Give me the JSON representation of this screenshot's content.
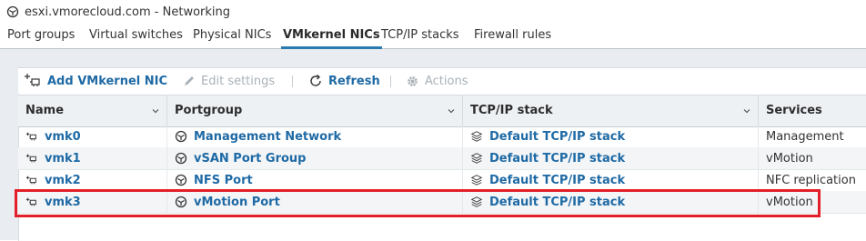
{
  "window": {
    "title": "esxi.vmorecloud.com - Networking",
    "icon": "globe-network-icon"
  },
  "tabs": [
    {
      "label": "Port groups",
      "active": false
    },
    {
      "label": "Virtual switches",
      "active": false
    },
    {
      "label": "Physical NICs",
      "active": false
    },
    {
      "label": "VMkernel NICs",
      "active": true
    },
    {
      "label": "TCP/IP stacks",
      "active": false
    },
    {
      "label": "Firewall rules",
      "active": false
    }
  ],
  "toolbar": {
    "add_label": "Add VMkernel NIC",
    "edit_label": "Edit settings",
    "refresh_label": "Refresh",
    "actions_label": "Actions"
  },
  "table": {
    "columns": [
      "Name",
      "Portgroup",
      "TCP/IP stack",
      "Services"
    ],
    "rows": [
      {
        "name": "vmk0",
        "portgroup": "Management Network",
        "stack": "Default TCP/IP stack",
        "services": "Management"
      },
      {
        "name": "vmk1",
        "portgroup": "vSAN Port Group",
        "stack": "Default TCP/IP stack",
        "services": "vMotion"
      },
      {
        "name": "vmk2",
        "portgroup": "NFS Port",
        "stack": "Default TCP/IP stack",
        "services": "NFC replication"
      },
      {
        "name": "vmk3",
        "portgroup": "vMotion Port",
        "stack": "Default TCP/IP stack",
        "services": "vMotion"
      }
    ]
  },
  "colors": {
    "link": "#1f6aa5",
    "highlight": "#e3202a",
    "active_tab_underline": "#2a7ab0"
  }
}
